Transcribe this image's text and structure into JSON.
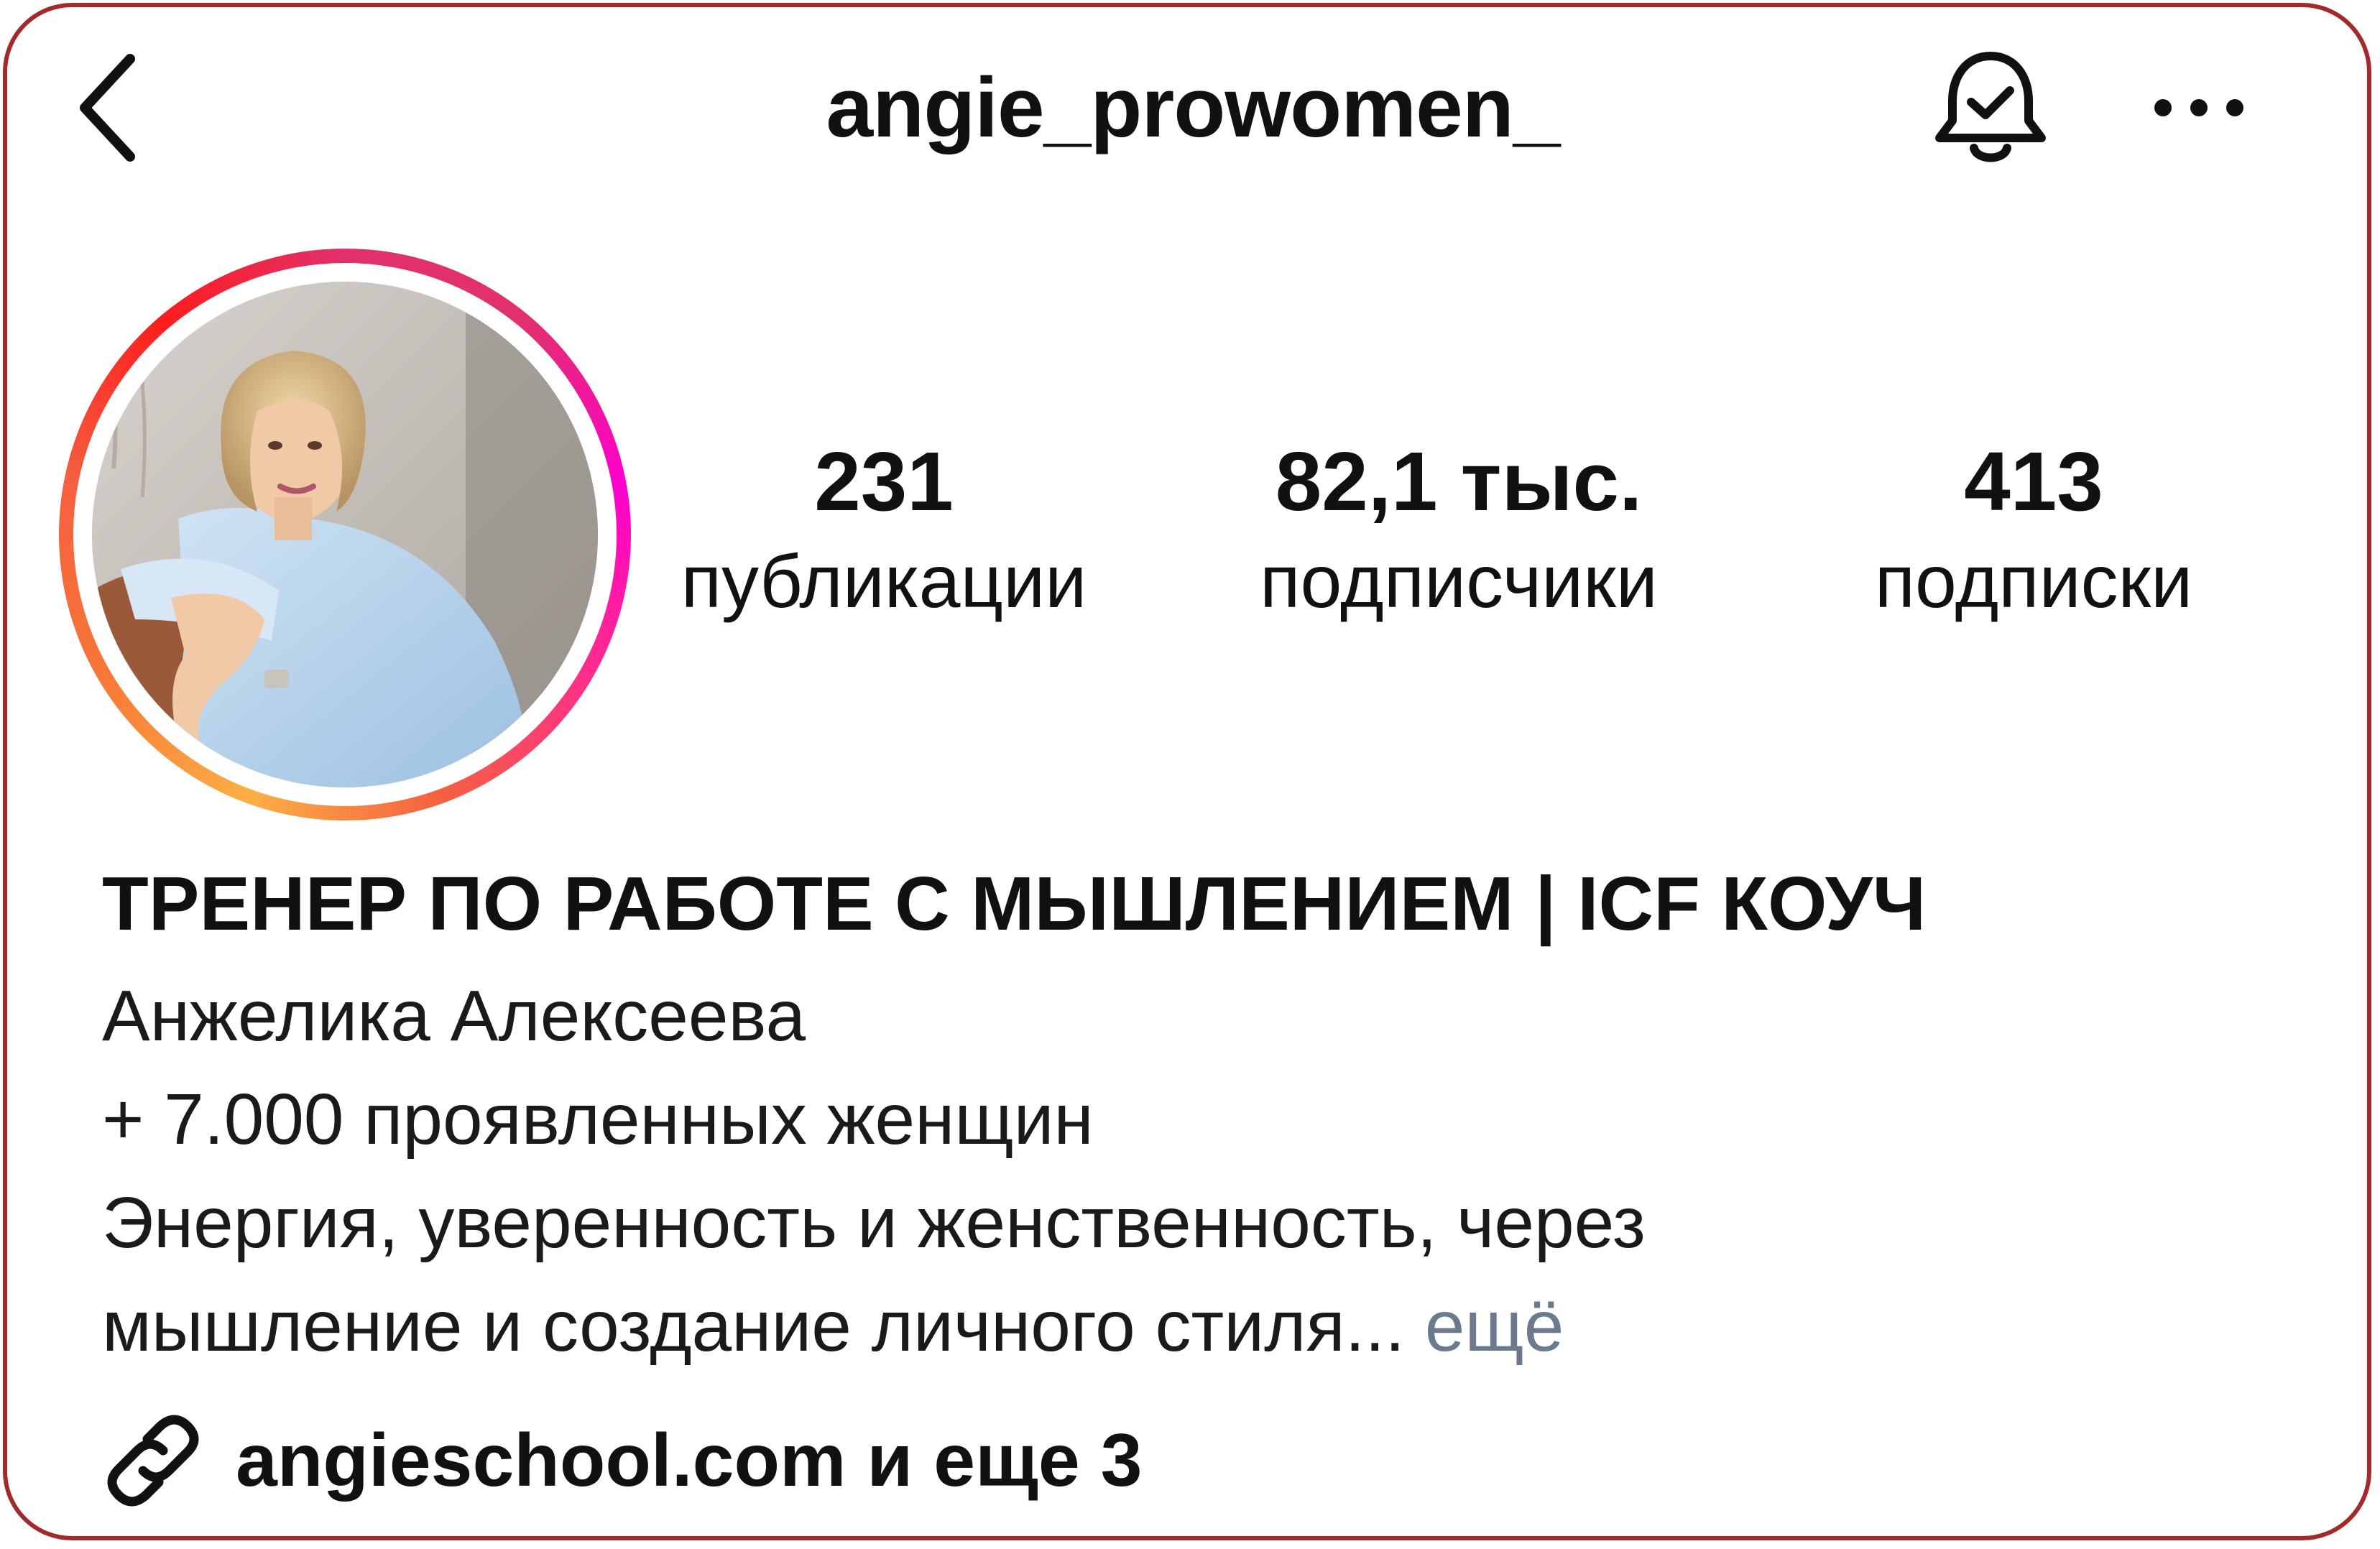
{
  "header": {
    "username": "angie_prowomen_",
    "back_icon": "chevron-left-icon",
    "bell_icon": "bell-check-icon",
    "more_icon": "more-horizontal-icon"
  },
  "profile": {
    "avatar_ring_colors": [
      "#fcaf45",
      "#f77737",
      "#fd1d1d",
      "#e1306c",
      "#ff00cc"
    ]
  },
  "stats": {
    "posts": {
      "value": "231",
      "label": "публикации"
    },
    "followers": {
      "value": "82,1 тыс.",
      "label": "подписчики"
    },
    "following": {
      "value": "413",
      "label": "подписки"
    }
  },
  "bio": {
    "title": "ТРЕНЕР ПО РАБОТЕ С МЫШЛЕНИЕМ | ICF КОУЧ",
    "name": "Анжелика Алексеева",
    "line2": "+ 7.000 проявленных женщин",
    "line3": "Энергия, уверенность и женственность, через",
    "line4": "мышление и создание личного стиля...",
    "more_label": "ещё",
    "more_color": "#6b7a8f"
  },
  "link": {
    "icon": "link-icon",
    "text": "angieschool.com и еще 3"
  },
  "colors": {
    "frame_border": "#a32a2a",
    "text": "#111111"
  }
}
